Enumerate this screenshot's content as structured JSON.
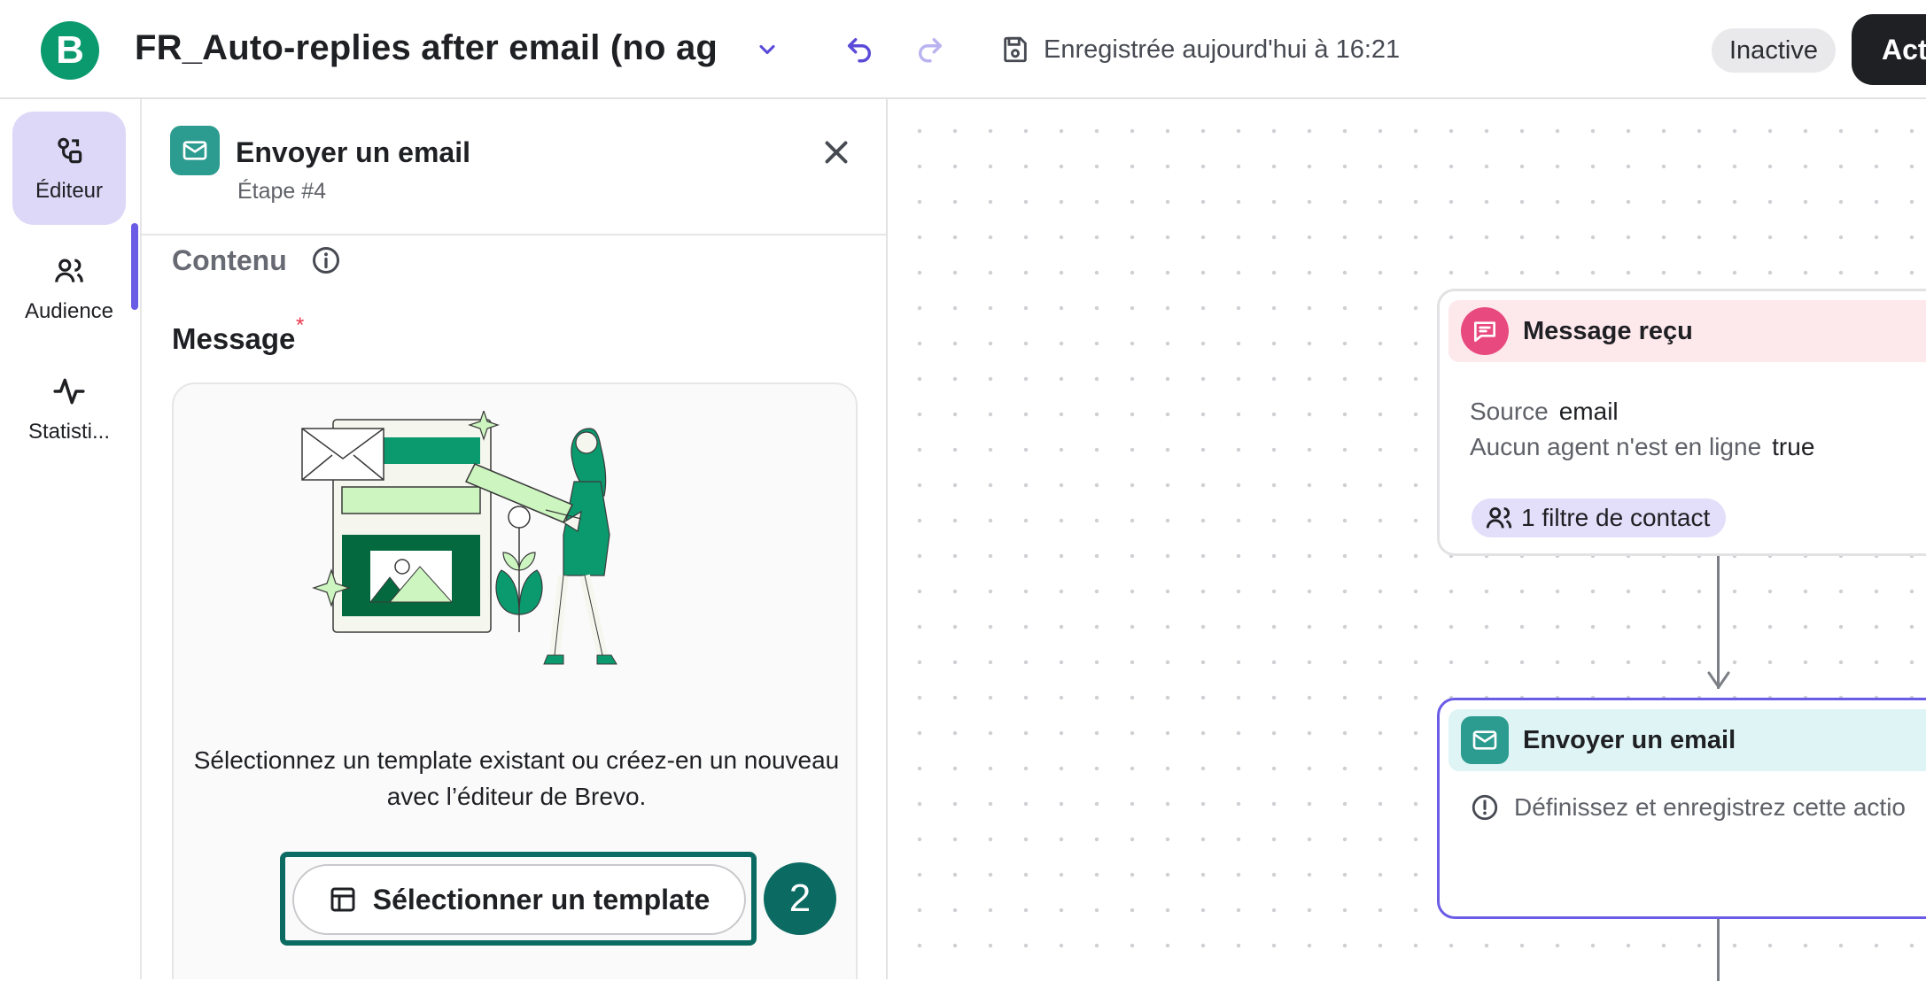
{
  "header": {
    "logo_letter": "B",
    "title": "FR_Auto-replies after email (no ag",
    "saved_status": "Enregistrée aujourd'hui à 16:21",
    "status_badge": "Inactive",
    "activate_label": "Acti"
  },
  "leftnav": {
    "items": [
      {
        "label": "Éditeur",
        "icon": "editor-icon",
        "active": true
      },
      {
        "label": "Audience",
        "icon": "audience-icon",
        "active": false
      },
      {
        "label": "Statisti...",
        "icon": "statistics-icon",
        "active": false
      }
    ]
  },
  "panel": {
    "title": "Envoyer un email",
    "subtitle": "Étape #4",
    "section_label": "Contenu",
    "message_label": "Message",
    "required_marker": "*",
    "card_text": "Sélectionnez un template existant ou créez-en un nouveau avec l’éditeur de Brevo.",
    "select_template_label": "Sélectionner un template",
    "step_marker": "2"
  },
  "canvas": {
    "node_trigger": {
      "title": "Message reçu",
      "fields": [
        {
          "key": "Source",
          "value": "email"
        },
        {
          "key": "Aucun agent n'est en ligne",
          "value": "true"
        }
      ],
      "filter_pill": "1 filtre de contact"
    },
    "node_action": {
      "title": "Envoyer un email",
      "warning": "Définissez et enregistrez cette actio"
    }
  },
  "colors": {
    "brand": "#0b996e",
    "accent": "#6b5ce6",
    "focus": "#0b6b63",
    "email_step": "#2c9b90",
    "message_trigger": "#e8497f"
  }
}
